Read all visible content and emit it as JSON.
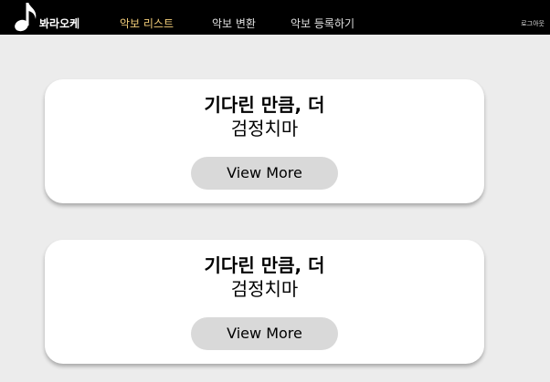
{
  "brand": {
    "icon": "music-note-icon",
    "name": "봐라오케"
  },
  "nav": {
    "items": [
      {
        "label": "악보 리스트",
        "active": true
      },
      {
        "label": "악보 변환",
        "active": false
      },
      {
        "label": "악보 등록하기",
        "active": false
      }
    ],
    "logout_label": "로그아웃"
  },
  "colors": {
    "topbar_bg": "#000000",
    "active_nav": "#f5cf7a",
    "page_bg": "#ececec",
    "button_bg": "#d9d9d9"
  },
  "cards": [
    {
      "title": "기다린 만큼, 더",
      "artist": "검정치마",
      "button_label": "View More"
    },
    {
      "title": "기다린 만큼, 더",
      "artist": "검정치마",
      "button_label": "View More"
    }
  ]
}
